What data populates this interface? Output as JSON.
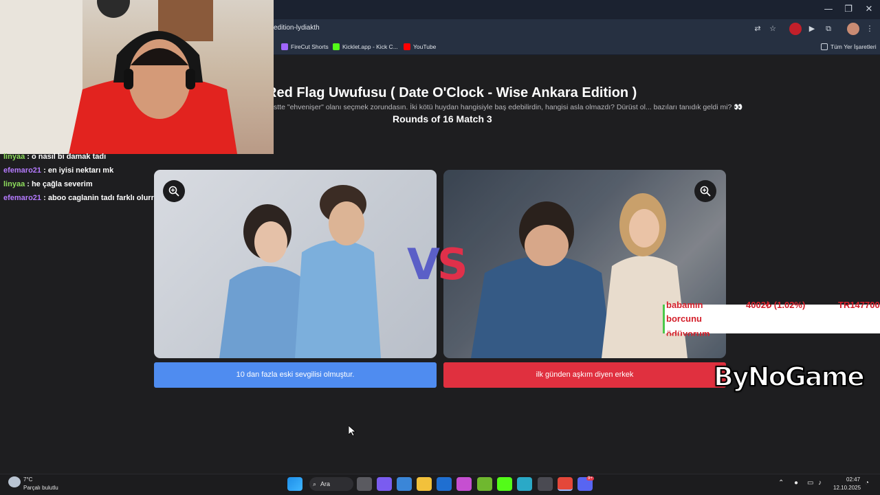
{
  "browser": {
    "url_fragment": "edition-lydiakth",
    "bookmarks": [
      {
        "label": "FireCut Shorts",
        "color": "#a066ff"
      },
      {
        "label": "Kicklet.app - Kick C...",
        "color": "#53fc18"
      },
      {
        "label": "YouTube",
        "color": "#ff0000"
      }
    ],
    "all_bookmarks_label": "Tüm Yer İşaretleri"
  },
  "page": {
    "title": "Red Flag Uwufusu ( Date O'Clock - Wise Ankara Edition )",
    "description": "stte \"ehvenişer\" olanı seçmek zorundasın. İki kötü huydan hangisiyle baş edebilirdin, hangisi asla olmazdı? Dürüst ol... bazıları tanıdık geldi mi? 👀",
    "round": "Rounds of 16 Match 3",
    "vs_left": "V",
    "vs_right": "S",
    "left_option": "10 dan fazla eski sevgilisi olmuştur.",
    "right_option": "ilk günden aşkım diyen erkek"
  },
  "chat": [
    {
      "user": "linyaa",
      "message": " : o nasıl bi damak tadı",
      "color": "#8fde5d"
    },
    {
      "user": "efemaro21",
      "message": " : en iyisi nektarı mk",
      "color": "#b57bff"
    },
    {
      "user": "linyaa",
      "message": " : he çağla severim",
      "color": "#8fde5d"
    },
    {
      "user": "efemaro21",
      "message": " : aboo caglanin tadı farklı olurr",
      "color": "#b57bff"
    }
  ],
  "donation": {
    "line1": "babamın",
    "line2": "borcunu",
    "line3": "ödüyorum",
    "amount": "4002₺ (1.02%)",
    "code": "TR147700"
  },
  "brand": "ByNoGame",
  "taskbar": {
    "temperature": "7°C",
    "weather": "Parçalı bulutlu",
    "search_label": "Ara",
    "time": "02:47",
    "date": "12.10.2025",
    "discord_badge": "9+"
  },
  "colors": {
    "left_button": "#4f8cf0",
    "right_button": "#e0303f",
    "vs_blue": "#5b5fc7",
    "vs_red": "#e0304a"
  }
}
